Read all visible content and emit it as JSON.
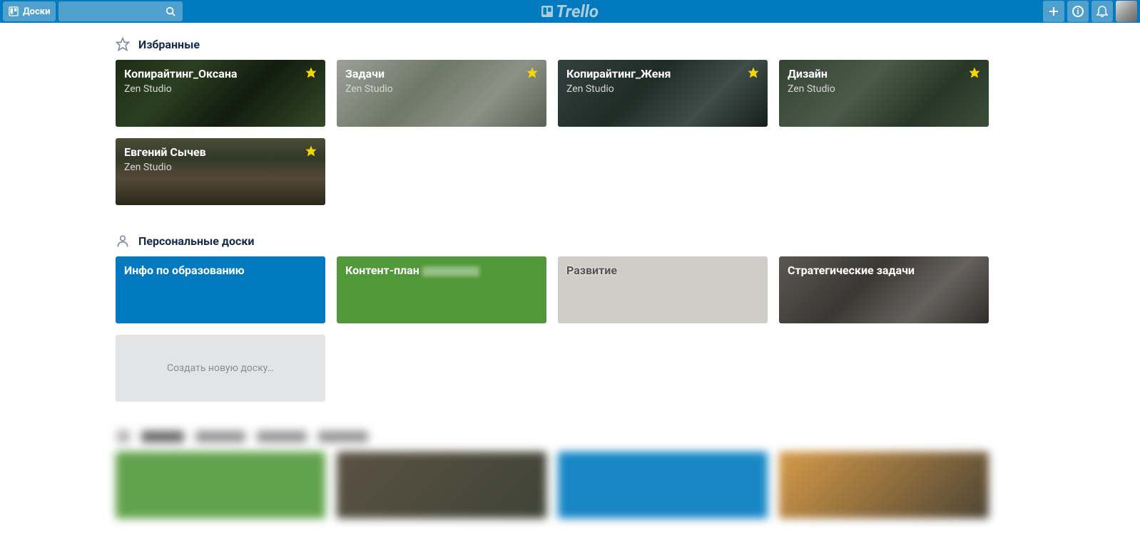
{
  "header": {
    "boards_label": "Доски",
    "logo_text": "Trello"
  },
  "sections": {
    "starred": {
      "title": "Избранные",
      "boards": [
        {
          "title": "Копирайтинг_Оксана",
          "team": "Zen Studio",
          "starred": true
        },
        {
          "title": "Задачи",
          "team": "Zen Studio",
          "starred": true
        },
        {
          "title": "Копирайтинг_Женя",
          "team": "Zen Studio",
          "starred": true
        },
        {
          "title": "Дизайн",
          "team": "Zen Studio",
          "starred": true
        },
        {
          "title": "Евгений Сычев",
          "team": "Zen Studio",
          "starred": true
        }
      ]
    },
    "personal": {
      "title": "Персональные доски",
      "boards": [
        {
          "title": "Инфо по образованию"
        },
        {
          "title": "Контент-план"
        },
        {
          "title": "Развитие"
        },
        {
          "title": "Стратегические задачи"
        }
      ],
      "create_label": "Создать новую доску…"
    }
  }
}
